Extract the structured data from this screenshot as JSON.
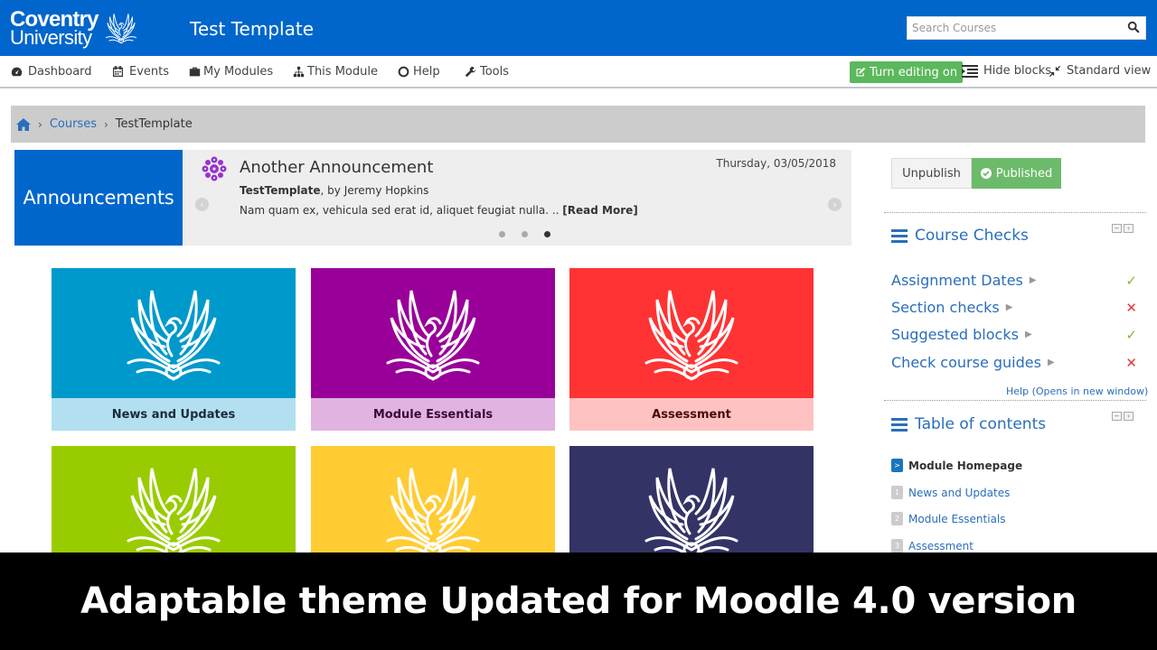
{
  "header": {
    "logo_line1": "Coventry",
    "logo_line2": "University",
    "site_title": "Test Template",
    "search_placeholder": "Search Courses",
    "colors": {
      "header_bg": "#0066cc"
    }
  },
  "nav": {
    "items": [
      {
        "label": "Dashboard",
        "icon": "dashboard-icon"
      },
      {
        "label": "Events",
        "icon": "calendar-icon"
      },
      {
        "label": "My Modules",
        "icon": "briefcase-icon"
      },
      {
        "label": "This Module",
        "icon": "sitemap-icon"
      },
      {
        "label": "Help",
        "icon": "lifebuoy-icon"
      },
      {
        "label": "Tools",
        "icon": "wrench-icon"
      }
    ],
    "edit_button": "Turn editing on",
    "hide_blocks": "Hide blocks",
    "standard_view": "Standard view"
  },
  "breadcrumb": {
    "items": [
      "Courses",
      "TestTemplate"
    ]
  },
  "announcements": {
    "label": "Announcements",
    "title": "Another Announcement",
    "date": "Thursday, 03/05/2018",
    "course": "TestTemplate",
    "author": ", by Jeremy Hopkins",
    "text": "Nam quam ex, vehicula sed erat id, aliquet feugiat nulla. .. ",
    "read_more": "[Read More]",
    "slide_count": 3,
    "active_slide": 3
  },
  "tiles": [
    {
      "label": "News and Updates",
      "color": "#0099cc",
      "caption_bg": "#b3e0f0",
      "caption_color": "#1a2a3a"
    },
    {
      "label": "Module Essentials",
      "color": "#990099",
      "caption_bg": "#e0b3e0",
      "caption_color": "#3a0a3a"
    },
    {
      "label": "Assessment",
      "color": "#ff3333",
      "caption_bg": "#ffc2c2",
      "caption_color": "#4a0a0a"
    },
    {
      "label": "",
      "color": "#99cc00",
      "caption_bg": "",
      "caption_color": ""
    },
    {
      "label": "",
      "color": "#ffcc33",
      "caption_bg": "",
      "caption_color": ""
    },
    {
      "label": "",
      "color": "#333366",
      "caption_bg": "",
      "caption_color": ""
    }
  ],
  "sidebar": {
    "unpublish": "Unpublish",
    "published": "Published",
    "course_checks": {
      "title": "Course Checks",
      "items": [
        {
          "label": "Assignment Dates",
          "status": "pass"
        },
        {
          "label": "Section checks",
          "status": "fail"
        },
        {
          "label": "Suggested blocks",
          "status": "pass"
        },
        {
          "label": "Check course guides",
          "status": "fail"
        }
      ],
      "help": "Help (Opens in new window)"
    },
    "toc": {
      "title": "Table of contents",
      "items": [
        {
          "num": ">",
          "label": "Module Homepage",
          "active": true
        },
        {
          "num": "1",
          "label": "News and Updates",
          "active": false
        },
        {
          "num": "2",
          "label": "Module Essentials",
          "active": false
        },
        {
          "num": "3",
          "label": "Assessment",
          "active": false
        }
      ]
    }
  },
  "banner": {
    "text": "Adaptable theme Updated for Moodle 4.0 version"
  }
}
